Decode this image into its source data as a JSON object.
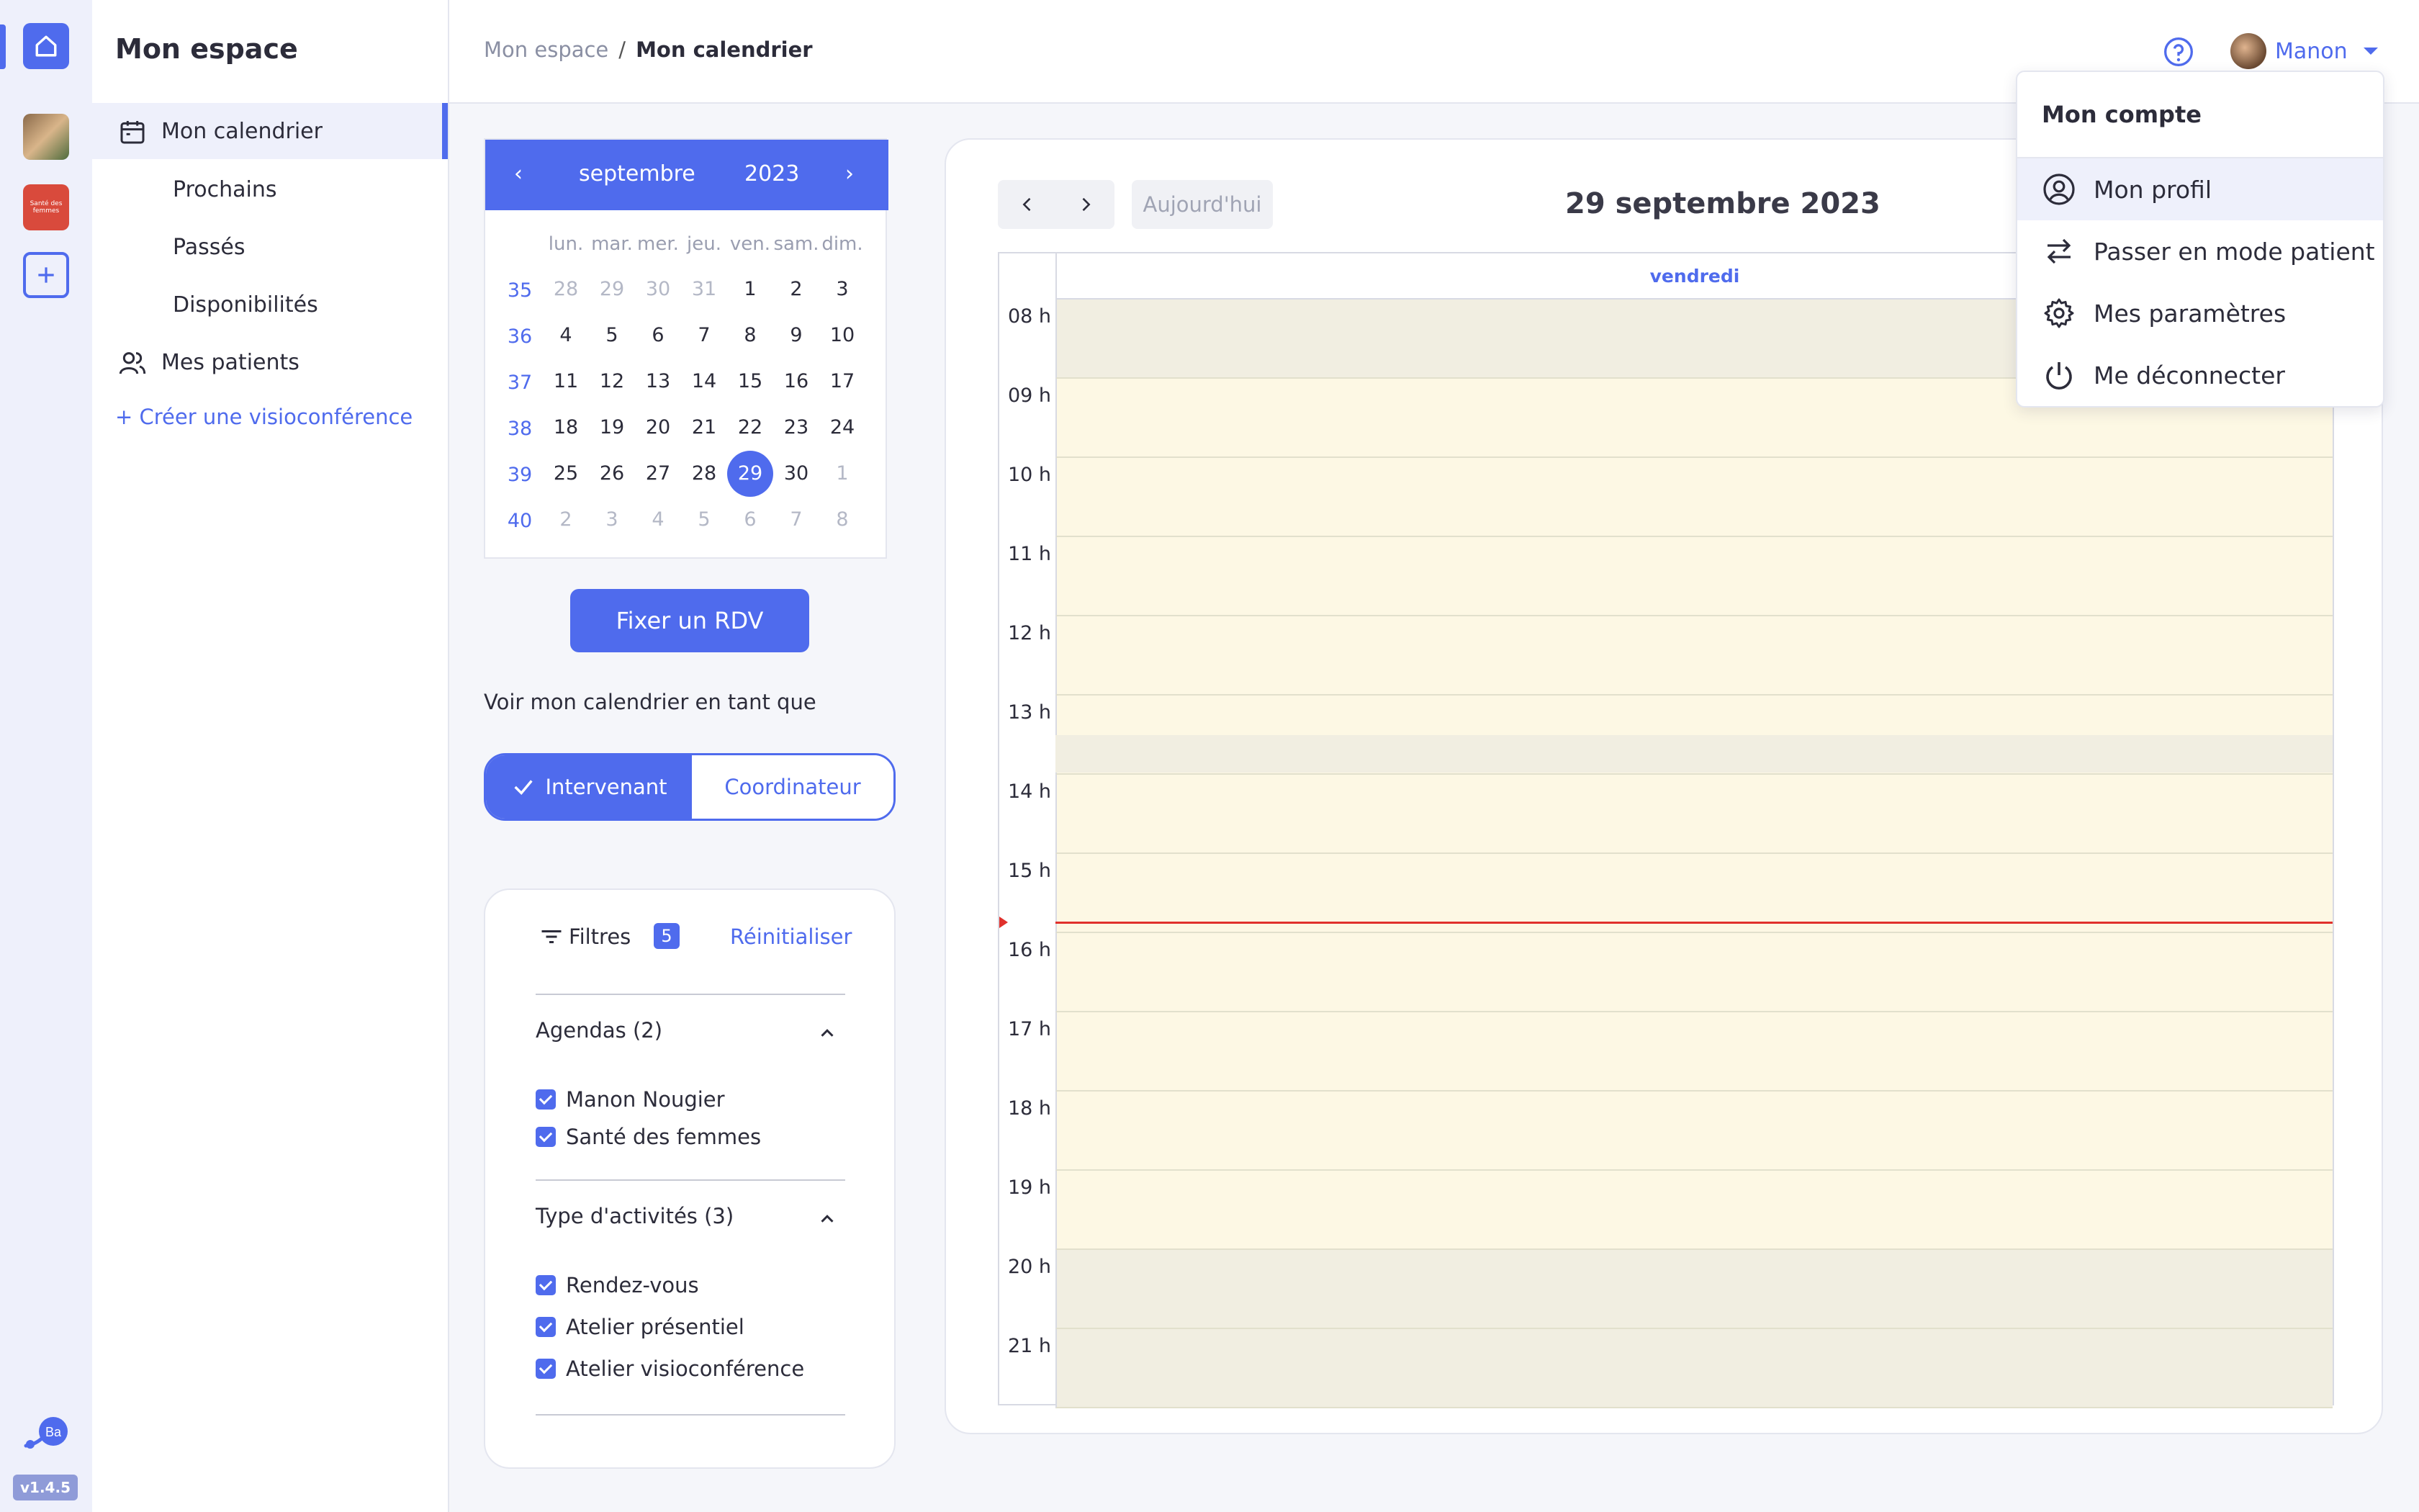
{
  "app": {
    "version": "v1.4.5",
    "org_logo_text": "Santé des femmes"
  },
  "sidenav": {
    "title": "Mon espace",
    "items": [
      {
        "label": "Mon calendrier"
      },
      {
        "label": "Prochains"
      },
      {
        "label": "Passés"
      },
      {
        "label": "Disponibilités"
      },
      {
        "label": "Mes patients"
      }
    ],
    "create_link": "+ Créer une visioconférence"
  },
  "header": {
    "breadcrumb": {
      "parent": "Mon espace",
      "separator": "/",
      "current": "Mon calendrier"
    },
    "user_name": "Manon"
  },
  "mini_calendar": {
    "month": "septembre",
    "year": "2023",
    "prev": "‹",
    "next": "›",
    "days_of_week": [
      "lun.",
      "mar.",
      "mer.",
      "jeu.",
      "ven.",
      "sam.",
      "dim."
    ],
    "weeks": [
      {
        "num": "35",
        "days": [
          [
            "28",
            1
          ],
          [
            "29",
            1
          ],
          [
            "30",
            1
          ],
          [
            "31",
            1
          ],
          [
            "1",
            0
          ],
          [
            "2",
            0
          ],
          [
            "3",
            0
          ]
        ]
      },
      {
        "num": "36",
        "days": [
          [
            "4",
            0
          ],
          [
            "5",
            0
          ],
          [
            "6",
            0
          ],
          [
            "7",
            0
          ],
          [
            "8",
            0
          ],
          [
            "9",
            0
          ],
          [
            "10",
            0
          ]
        ]
      },
      {
        "num": "37",
        "days": [
          [
            "11",
            0
          ],
          [
            "12",
            0
          ],
          [
            "13",
            0
          ],
          [
            "14",
            0
          ],
          [
            "15",
            0
          ],
          [
            "16",
            0
          ],
          [
            "17",
            0
          ]
        ]
      },
      {
        "num": "38",
        "days": [
          [
            "18",
            0
          ],
          [
            "19",
            0
          ],
          [
            "20",
            0
          ],
          [
            "21",
            0
          ],
          [
            "22",
            0
          ],
          [
            "23",
            0
          ],
          [
            "24",
            0
          ]
        ]
      },
      {
        "num": "39",
        "days": [
          [
            "25",
            0
          ],
          [
            "26",
            0
          ],
          [
            "27",
            0
          ],
          [
            "28",
            0
          ],
          [
            "29",
            2
          ],
          [
            "30",
            0
          ],
          [
            "1",
            1
          ]
        ]
      },
      {
        "num": "40",
        "days": [
          [
            "2",
            1
          ],
          [
            "3",
            1
          ],
          [
            "4",
            1
          ],
          [
            "5",
            1
          ],
          [
            "6",
            1
          ],
          [
            "7",
            1
          ],
          [
            "8",
            1
          ]
        ]
      }
    ]
  },
  "actions": {
    "rdv_button": "Fixer un RDV",
    "view_as_label": "Voir mon calendrier en tant que",
    "role_selected": "Intervenant",
    "role_other": "Coordinateur"
  },
  "filters": {
    "title": "Filtres",
    "count": "5",
    "reset": "Réinitialiser",
    "groups": [
      {
        "title": "Agendas (2)",
        "items": [
          "Manon Nougier",
          "Santé des femmes"
        ]
      },
      {
        "title": "Type d'activités (3)",
        "items": [
          "Rendez-vous",
          "Atelier présentiel",
          "Atelier visioconférence"
        ]
      }
    ]
  },
  "day_view": {
    "today_button": "Aujourd'hui",
    "date_title": "29 septembre 2023",
    "day_name": "vendredi",
    "hours": [
      "08 h",
      "09 h",
      "10 h",
      "11 h",
      "12 h",
      "13 h",
      "14 h",
      "15 h",
      "16 h",
      "17 h",
      "18 h",
      "19 h",
      "20 h",
      "21 h"
    ],
    "colors": {
      "available": "#fdf8e4",
      "unavailable": "#f1eee1",
      "now_line": "#e0312c"
    }
  },
  "account_menu": {
    "title": "Mon compte",
    "items": [
      {
        "label": "Mon profil",
        "icon": "user-circle-icon"
      },
      {
        "label": "Passer en mode patient",
        "icon": "swap-arrows-icon"
      },
      {
        "label": "Mes paramètres",
        "icon": "gear-icon"
      },
      {
        "label": "Me déconnecter",
        "icon": "power-icon"
      }
    ]
  },
  "theme": {
    "accent": "#4f6bed"
  }
}
